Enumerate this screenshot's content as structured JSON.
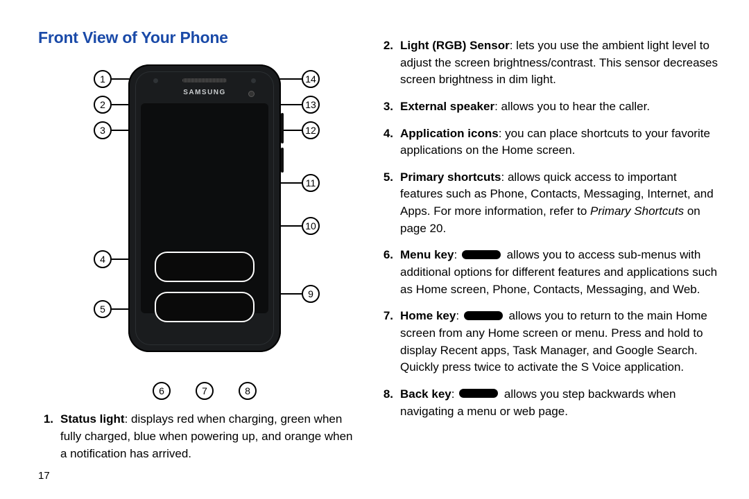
{
  "section_title": "Front View of Your Phone",
  "page_number": "17",
  "phone_brand": "SAMSUNG",
  "callouts": {
    "n1": "1",
    "n2": "2",
    "n3": "3",
    "n4": "4",
    "n5": "5",
    "n6": "6",
    "n7": "7",
    "n8": "8",
    "n9": "9",
    "n10": "10",
    "n11": "11",
    "n12": "12",
    "n13": "13",
    "n14": "14"
  },
  "items": [
    {
      "num": "1.",
      "term": "Status light",
      "text": ": displays red when charging, green when fully charged, blue when powering up, and orange when a notification has arrived."
    },
    {
      "num": "2.",
      "term": "Light (RGB) Sensor",
      "text": ": lets you use the ambient light level to adjust the screen brightness/contrast. This sensor decreases screen brightness in dim light."
    },
    {
      "num": "3.",
      "term": "External speaker",
      "text": ": allows you to hear the caller."
    },
    {
      "num": "4.",
      "term": "Application icons",
      "text": ": you can place shortcuts to your favorite applications on the Home screen."
    },
    {
      "num": "5.",
      "term": "Primary shortcuts",
      "text_before": ": allows quick access to important features such as Phone, Contacts, Messaging, Internet, and Apps. For more information, refer to ",
      "ref": "Primary Shortcuts",
      "text_after": " on page 20."
    },
    {
      "num": "6.",
      "term": "Menu key",
      "text_before": ": ",
      "pill": true,
      "text_after": " allows you to access sub-menus with additional options for different features and applications such as Home screen, Phone, Contacts, Messaging, and Web."
    },
    {
      "num": "7.",
      "term": "Home key",
      "text_before": ": ",
      "pill": true,
      "text_after": " allows you to return to the main Home screen from any Home screen or menu. Press and hold to display Recent apps, Task Manager, and Google Search. Quickly press twice to activate the S Voice application."
    },
    {
      "num": "8.",
      "term": "Back key",
      "text_before": ": ",
      "pill": true,
      "text_after": " allows you step backwards when navigating a menu or web page."
    }
  ]
}
